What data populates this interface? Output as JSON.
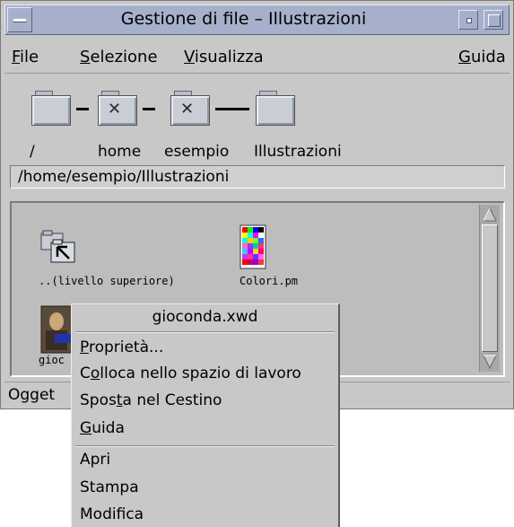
{
  "window": {
    "title": "Gestione di file – Illustrazioni"
  },
  "menubar": {
    "file": {
      "accel": "F",
      "rest": "ile"
    },
    "selezione": {
      "accel": "S",
      "rest": "elezione"
    },
    "visualizza": {
      "accel": "V",
      "rest": "isualizza"
    },
    "guida": {
      "accel": "G",
      "rest": "uida"
    }
  },
  "iconpath": {
    "labels": [
      "/",
      "home",
      "esempio",
      "Illustrazioni"
    ]
  },
  "pathfield": {
    "value": "/home/esempio/Illustrazioni"
  },
  "files": [
    {
      "label": "..(livello superiore)",
      "icon": "parent-folder-icon"
    },
    {
      "label": "Colori.pm",
      "icon": "color-palette-icon"
    },
    {
      "label": "gioc",
      "icon": "xwd-image-icon"
    }
  ],
  "statusbar": {
    "text": "Ogget"
  },
  "popup": {
    "title": "gioconda.xwd",
    "items": [
      {
        "pre": "",
        "accel": "P",
        "post": "roprietà..."
      },
      {
        "pre": "C",
        "accel": "o",
        "post": "lloca nello spazio di lavoro"
      },
      {
        "pre": "Spos",
        "accel": "t",
        "post": "a nel Cestino"
      },
      {
        "pre": "",
        "accel": "G",
        "post": "uida"
      }
    ],
    "actions": [
      "Apri",
      "Stampa",
      "Modifica"
    ]
  }
}
